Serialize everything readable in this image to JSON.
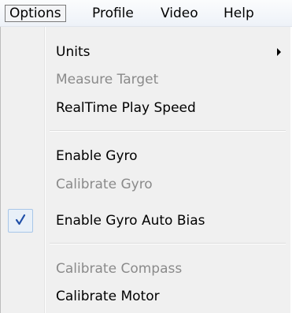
{
  "menubar": {
    "items": [
      {
        "label": "Options"
      },
      {
        "label": "Profile"
      },
      {
        "label": "Video"
      },
      {
        "label": "Help"
      }
    ]
  },
  "options_menu": {
    "items": [
      {
        "label": "Units",
        "enabled": true,
        "has_submenu": true
      },
      {
        "label": "Measure Target",
        "enabled": false
      },
      {
        "label": "RealTime Play Speed",
        "enabled": true
      },
      {
        "label": "Enable Gyro",
        "enabled": true
      },
      {
        "label": "Calibrate Gyro",
        "enabled": false
      },
      {
        "label": "Enable Gyro Auto Bias",
        "enabled": true,
        "checked": true
      },
      {
        "label": "Calibrate Compass",
        "enabled": false
      },
      {
        "label": "Calibrate Motor",
        "enabled": true
      }
    ],
    "check_icon": "checkmark-icon",
    "submenu_icon": "submenu-arrow-icon",
    "check_color": "#1f4fa8"
  }
}
